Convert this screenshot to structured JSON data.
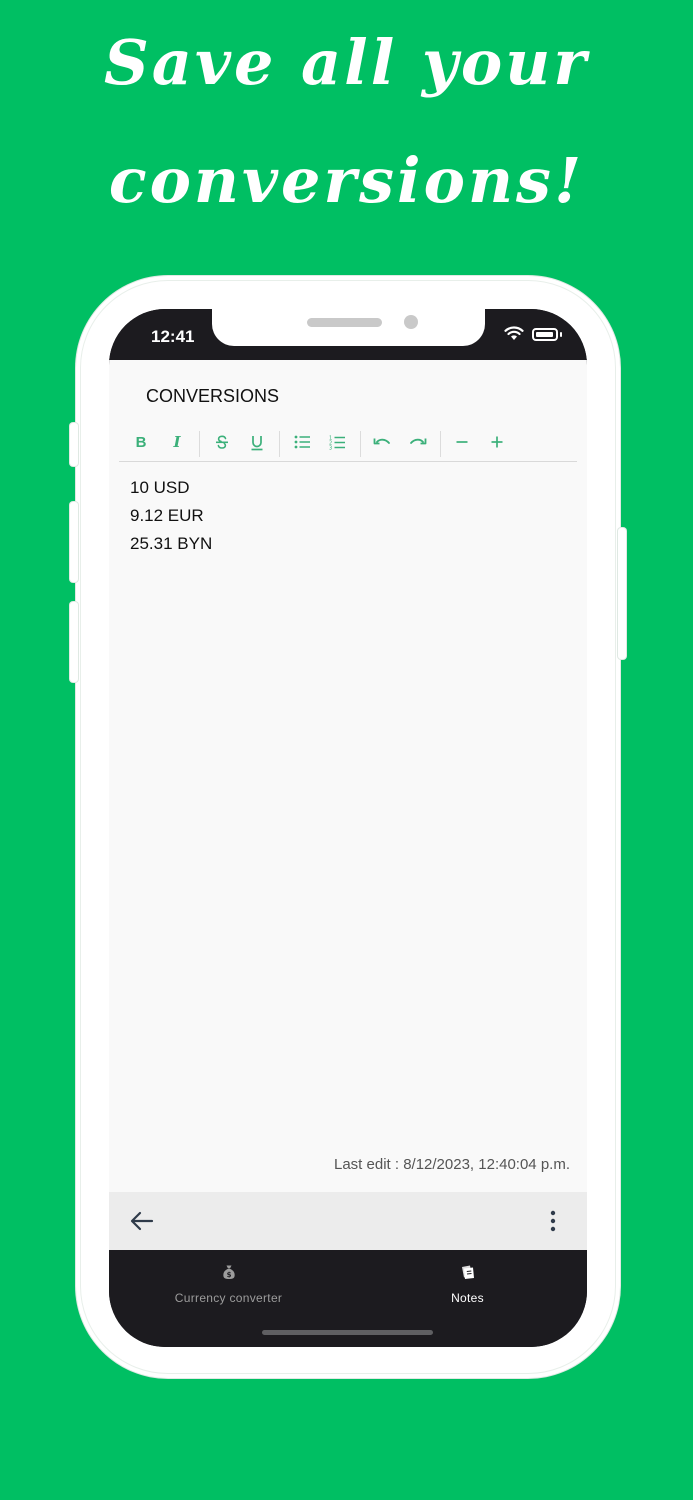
{
  "promo": {
    "headline_line1": "Save all your",
    "headline_line2": "conversions!"
  },
  "status_bar": {
    "time": "12:41"
  },
  "note": {
    "title": "CONVERSIONS",
    "lines": [
      "10 USD",
      "9.12 EUR",
      "25.31 BYN"
    ],
    "last_edit": "Last edit : 8/12/2023, 12:40:04 p.m."
  },
  "toolbar": {
    "bold": "B",
    "italic": "I"
  },
  "bottom_nav": {
    "items": [
      {
        "label": "Currency converter",
        "icon": "money-bag-icon",
        "active": false
      },
      {
        "label": "Notes",
        "icon": "notes-icon",
        "active": true
      }
    ]
  },
  "colors": {
    "background": "#00bf63",
    "accent": "#3bb07a",
    "nav_bg": "#1c1b1f"
  }
}
